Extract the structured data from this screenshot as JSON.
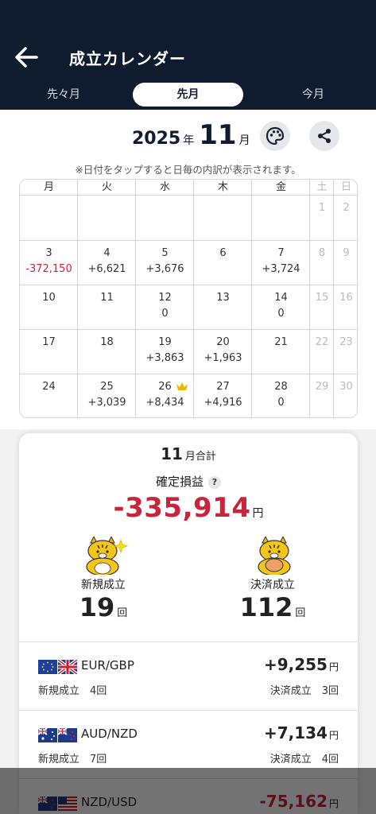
{
  "header": {
    "title": "成立カレンダー",
    "tabs": [
      "先々月",
      "先月",
      "今月"
    ],
    "active_tab": "先月"
  },
  "calendar": {
    "year": "2025",
    "year_unit": "年",
    "month": "11",
    "month_unit": "月",
    "note": "※日付をタップすると日毎の内訳が表示されます。",
    "weekdays": [
      "月",
      "火",
      "水",
      "木",
      "金",
      "土",
      "日"
    ],
    "weeks": [
      [
        {
          "d": "",
          "v": ""
        },
        {
          "d": "",
          "v": ""
        },
        {
          "d": "",
          "v": ""
        },
        {
          "d": "",
          "v": ""
        },
        {
          "d": "",
          "v": ""
        },
        {
          "d": "1",
          "v": ""
        },
        {
          "d": "2",
          "v": ""
        }
      ],
      [
        {
          "d": "3",
          "v": "-372,150"
        },
        {
          "d": "4",
          "v": "+6,621"
        },
        {
          "d": "5",
          "v": "+3,676"
        },
        {
          "d": "6",
          "v": ""
        },
        {
          "d": "7",
          "v": "+3,724"
        },
        {
          "d": "8",
          "v": ""
        },
        {
          "d": "9",
          "v": ""
        }
      ],
      [
        {
          "d": "10",
          "v": ""
        },
        {
          "d": "11",
          "v": ""
        },
        {
          "d": "12",
          "v": "0"
        },
        {
          "d": "13",
          "v": ""
        },
        {
          "d": "14",
          "v": "0"
        },
        {
          "d": "15",
          "v": ""
        },
        {
          "d": "16",
          "v": ""
        }
      ],
      [
        {
          "d": "17",
          "v": ""
        },
        {
          "d": "18",
          "v": ""
        },
        {
          "d": "19",
          "v": "+3,863"
        },
        {
          "d": "20",
          "v": "+1,963"
        },
        {
          "d": "21",
          "v": ""
        },
        {
          "d": "22",
          "v": ""
        },
        {
          "d": "23",
          "v": ""
        }
      ],
      [
        {
          "d": "24",
          "v": ""
        },
        {
          "d": "25",
          "v": "+3,039"
        },
        {
          "d": "26",
          "v": "+8,434",
          "crown": true
        },
        {
          "d": "27",
          "v": "+4,916"
        },
        {
          "d": "28",
          "v": "0"
        },
        {
          "d": "29",
          "v": ""
        },
        {
          "d": "30",
          "v": ""
        }
      ]
    ]
  },
  "summary": {
    "month": "11",
    "month_label": "月合計",
    "label": "確定損益",
    "help": "?",
    "total": "-335,914",
    "yen": "円",
    "new_label": "新規成立",
    "new_count": "19",
    "settle_label": "決済成立",
    "settle_count": "112",
    "count_unit": "回"
  },
  "pairs": [
    {
      "name": "EUR/GBP",
      "value": "+9,255",
      "yen": "円",
      "new_text": "新規成立　4回",
      "settle_text": "決済成立　3回",
      "flags": [
        "eu",
        "uk"
      ]
    },
    {
      "name": "AUD/NZD",
      "value": "+7,134",
      "yen": "円",
      "new_text": "新規成立　7回",
      "settle_text": "決済成立　4回",
      "flags": [
        "au",
        "nz"
      ]
    },
    {
      "name": "NZD/USD",
      "value": "-75,162",
      "yen": "円",
      "new_text": "",
      "settle_text": "",
      "flags": [
        "nz",
        "us"
      ]
    }
  ],
  "colors": {
    "header_bg": "#0f1c30",
    "negative": "#c8243a",
    "weekend": "#bbbbbb"
  },
  "icons": [
    "back-arrow-icon",
    "palette-icon",
    "share-icon",
    "crown-icon",
    "help-icon",
    "tiger-mascot-icon"
  ]
}
